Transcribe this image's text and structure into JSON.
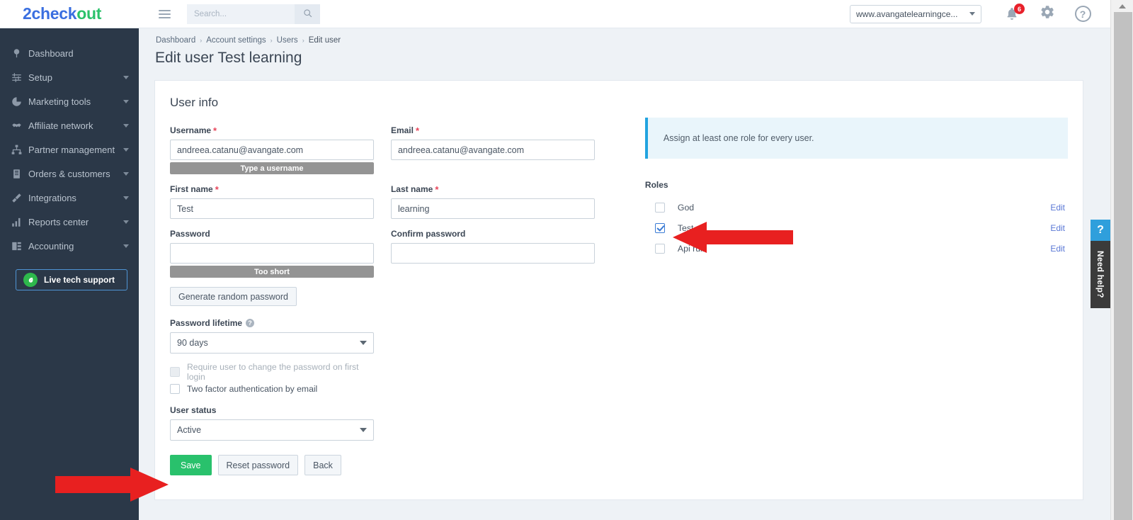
{
  "brand": {
    "logo_part1": "2check",
    "logo_part2": "out",
    "color_blue": "#3a6fe0",
    "color_green": "#2bc26b"
  },
  "topbar": {
    "menu_icon": "hamburger-icon",
    "search_placeholder": "Search...",
    "search_value": "",
    "search_icon": "search-icon",
    "account": "www.avangatelearningce...",
    "notifications_icon": "bell-icon",
    "notifications_count": "6",
    "settings_icon": "gear-icon",
    "help_icon": "question-circle-icon"
  },
  "sidebar": {
    "items": [
      {
        "label": "Dashboard",
        "icon": "dashboard-icon",
        "expandable": false
      },
      {
        "label": "Setup",
        "icon": "sliders-icon",
        "expandable": true
      },
      {
        "label": "Marketing tools",
        "icon": "pie-chart-icon",
        "expandable": true
      },
      {
        "label": "Affiliate network",
        "icon": "handshake-icon",
        "expandable": true
      },
      {
        "label": "Partner management",
        "icon": "sitemap-icon",
        "expandable": true
      },
      {
        "label": "Orders & customers",
        "icon": "clipboard-icon",
        "expandable": true
      },
      {
        "label": "Integrations",
        "icon": "plug-icon",
        "expandable": true
      },
      {
        "label": "Reports center",
        "icon": "bar-chart-icon",
        "expandable": true
      },
      {
        "label": "Accounting",
        "icon": "ledger-icon",
        "expandable": true
      }
    ],
    "support_button": {
      "label": "Live tech support",
      "icon": "leaf-circle-icon",
      "border_color": "#4f94d4",
      "icon_bg": "#2eb84c"
    }
  },
  "breadcrumb": {
    "items": [
      "Dashboard",
      "Account settings",
      "Users",
      "Edit user"
    ],
    "separator": "›"
  },
  "page": {
    "title": "Edit user Test learning"
  },
  "form": {
    "section_title": "User info",
    "username": {
      "label": "Username",
      "required": "*",
      "value": "andreea.catanu@avangate.com",
      "hint_bar": "Type a username"
    },
    "email": {
      "label": "Email",
      "required": "*",
      "value": "andreea.catanu@avangate.com"
    },
    "first_name": {
      "label": "First name",
      "required": "*",
      "value": "Test"
    },
    "last_name": {
      "label": "Last name",
      "required": "*",
      "value": "learning"
    },
    "password": {
      "label": "Password",
      "value": "",
      "strength_bar": "Too short"
    },
    "confirm_password": {
      "label": "Confirm password",
      "value": ""
    },
    "generate_button": "Generate random password",
    "password_lifetime": {
      "label": "Password lifetime",
      "help_icon": "question-mark-icon",
      "value": "90 days"
    },
    "require_change": {
      "label": "Require user to change the password on first login",
      "checked": false,
      "disabled": true
    },
    "two_factor": {
      "label": "Two factor authentication by email",
      "checked": false,
      "disabled": false
    },
    "user_status": {
      "label": "User status",
      "value": "Active"
    },
    "buttons": {
      "save": "Save",
      "reset_password": "Reset password",
      "back": "Back"
    }
  },
  "roles_panel": {
    "notice": "Assign at least one role for every user.",
    "notice_accent": "#22a4e0",
    "heading": "Roles",
    "edit_label": "Edit",
    "roles": [
      {
        "name": "God",
        "checked": false
      },
      {
        "name": "Test",
        "checked": true
      },
      {
        "name": "Api rulz",
        "checked": false
      }
    ]
  },
  "need_help": {
    "question_mark": "?",
    "label": "Need help?",
    "accent": "#2f9fdc"
  },
  "annotations": {
    "arrow_color": "#e82020",
    "arrows": [
      {
        "name": "arrow-pointing-to-test-role",
        "points_to": "Test role checkbox"
      },
      {
        "name": "arrow-pointing-to-save-button",
        "points_to": "Save button"
      }
    ]
  },
  "scrollbar": {
    "name": "vertical-scrollbar"
  }
}
